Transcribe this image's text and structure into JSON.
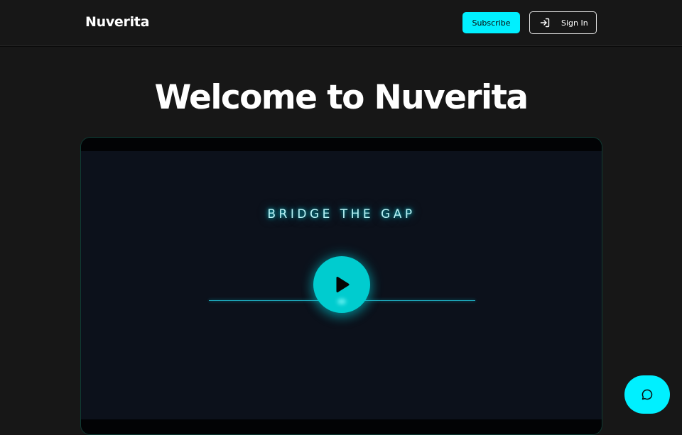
{
  "header": {
    "brand": "Nuverita",
    "subscribe_label": "Subscribe",
    "signin_label": "Sign In",
    "signin_icon": "sign-in-icon"
  },
  "hero": {
    "title": "Welcome to Nuverita"
  },
  "video": {
    "tagline": "BRIDGE THE GAP",
    "play_icon": "play-icon"
  },
  "chat": {
    "icon": "chat-bubble-icon"
  },
  "colors": {
    "background": "#171717",
    "accent": "#00f0ff",
    "play_button": "#00cccf",
    "video_bg": "#0c111b"
  }
}
